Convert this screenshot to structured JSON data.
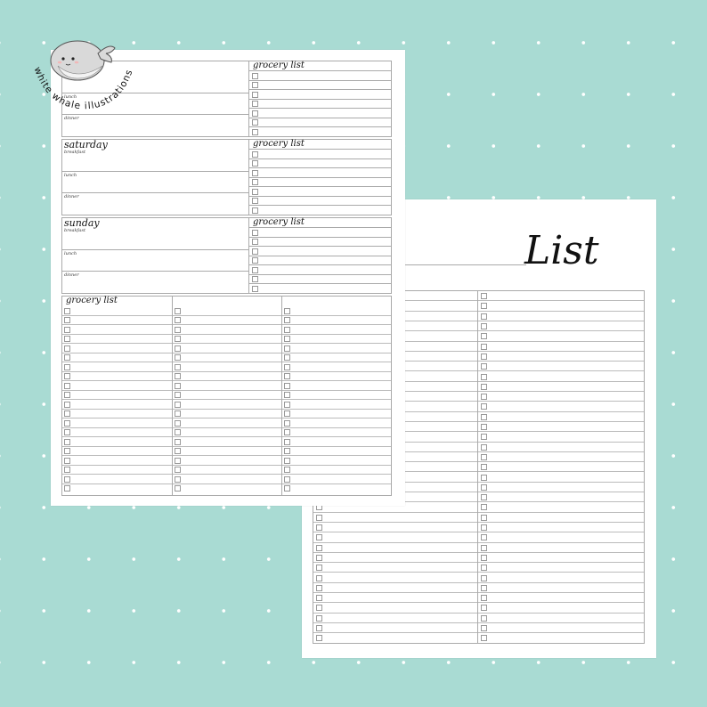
{
  "brand": {
    "name": "white whale illustrations",
    "mascot_icon": "whale-icon"
  },
  "left_sheet": {
    "blocks": [
      {
        "day": "",
        "meals": [
          "",
          "lunch",
          "dinner"
        ],
        "grocery_title": "grocery list"
      },
      {
        "day": "saturday",
        "meals": [
          "breakfast",
          "lunch",
          "dinner"
        ],
        "grocery_title": "grocery list"
      },
      {
        "day": "sunday",
        "meals": [
          "breakfast",
          "lunch",
          "dinner"
        ],
        "grocery_title": "grocery list"
      }
    ],
    "big_grocery_title": "grocery list"
  },
  "right_sheet": {
    "title": "List"
  },
  "colors": {
    "background": "#a9dbd3",
    "dots": "#ffffff",
    "paper": "#ffffff",
    "lines": "#aaaaaa"
  }
}
